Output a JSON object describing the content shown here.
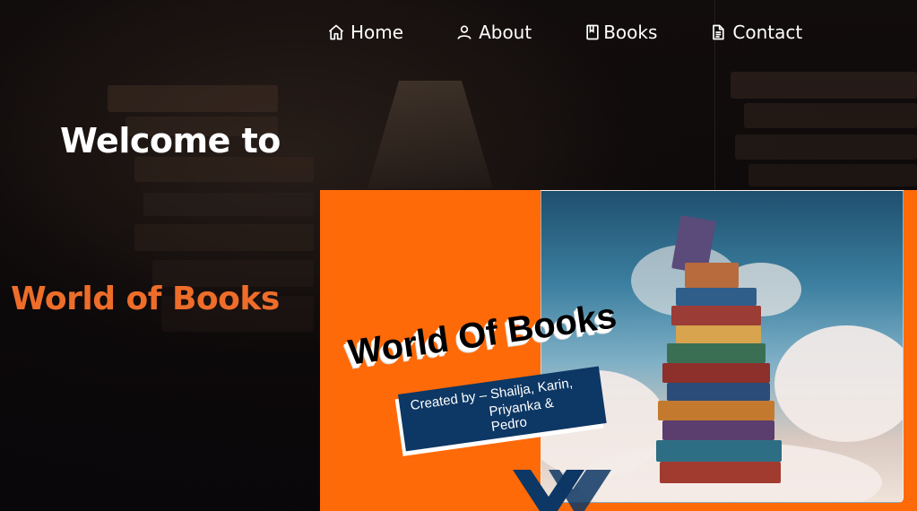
{
  "nav": {
    "items": [
      {
        "label": "Home",
        "icon": "home-icon"
      },
      {
        "label": "About",
        "icon": "user-icon"
      },
      {
        "label": "Books",
        "icon": "book-icon"
      },
      {
        "label": "Contact",
        "icon": "document-icon"
      }
    ]
  },
  "hero": {
    "welcome": "Welcome to",
    "brand": "World of Books"
  },
  "banner": {
    "title": "World Of Books",
    "credit_line1": "Created by – Shailja, Karin,",
    "credit_line2": "Priyanka & Pedro"
  },
  "colors": {
    "background": "#0d0a0b",
    "accent_orange": "#ee6d2a",
    "banner_orange": "#ff6a08",
    "credit_blue": "#0d3764",
    "text_white": "#ffffff"
  }
}
